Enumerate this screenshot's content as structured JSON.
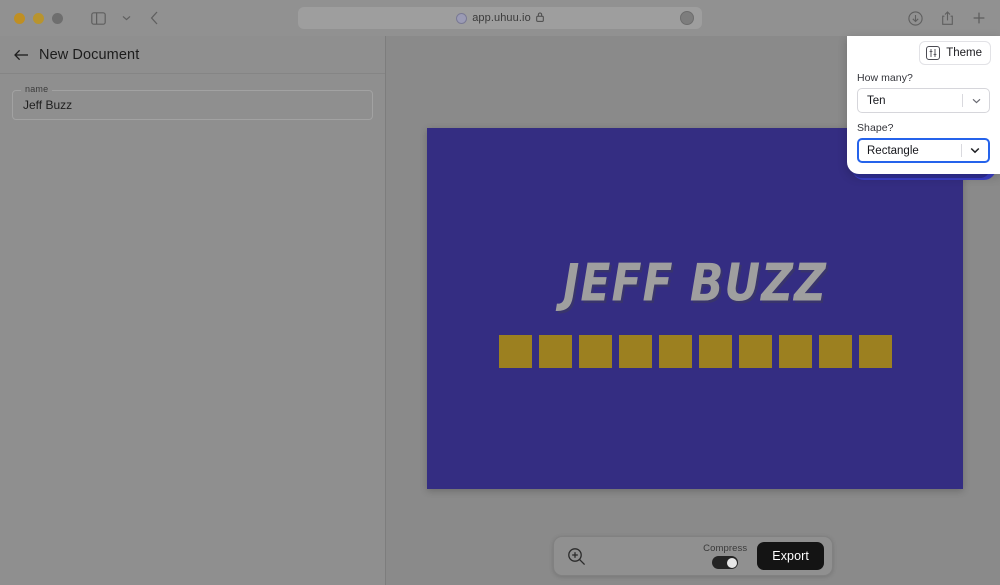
{
  "browser": {
    "traffic_lights": [
      "close",
      "minimize",
      "maximize"
    ],
    "sidebar_toggle_icon": "sidebar-panel-icon",
    "tab_overview_icon": "chevron-down-icon",
    "back_icon": "back-chevron-icon",
    "url": "app.uhuu.io",
    "lock_icon": "lock-icon",
    "favicon": "site-favicon",
    "extension_icon": "extension-icon",
    "right_icons": [
      "download-icon",
      "share-icon",
      "new-tab-icon"
    ]
  },
  "sidebar": {
    "back_icon": "back-arrow-icon",
    "title": "New Document",
    "name_field": {
      "legend": "name",
      "value": "Jeff Buzz",
      "placeholder": "name"
    }
  },
  "poster": {
    "title": "JEFF BUZZ",
    "background_color": "#342d82",
    "title_color": "#9f9f9f",
    "shape_color": "#9c8020",
    "shape_count": 10,
    "shape_type": "rectangle"
  },
  "bottom_bar": {
    "zoom_icon": "zoom-in-icon",
    "compress_label": "Compress",
    "compress_on": true,
    "export_label": "Export"
  },
  "theme_panel": {
    "button_label": "Theme",
    "button_icon": "tune-sliders-icon",
    "accent_color": "#3b3fc8",
    "focus_color": "#2563eb",
    "controls": [
      {
        "id": "how-many",
        "label": "How many?",
        "value": "Ten",
        "focused": false,
        "caret_icon": "chevron-down-icon"
      },
      {
        "id": "shape",
        "label": "Shape?",
        "value": "Rectangle",
        "focused": true,
        "caret_icon": "chevron-down-icon"
      }
    ]
  }
}
